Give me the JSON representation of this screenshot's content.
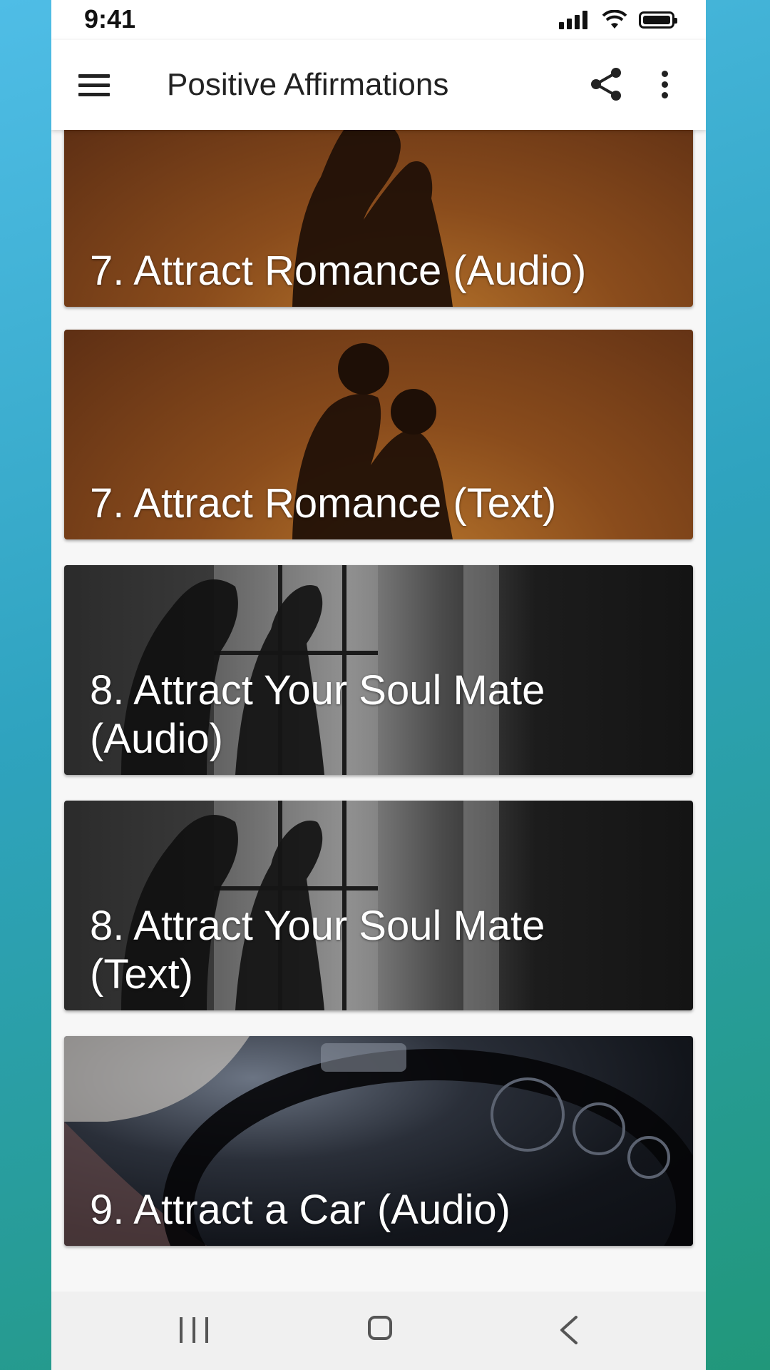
{
  "status_bar": {
    "time": "9:41",
    "icons": [
      "signal-icon",
      "wifi-icon",
      "battery-icon"
    ]
  },
  "app_bar": {
    "title": "Positive Affirmations",
    "icons": [
      "menu-icon",
      "share-icon",
      "more-vert-icon"
    ]
  },
  "list": {
    "items": [
      {
        "title": "7. Attract Romance (Audio)",
        "image": "couple-kissing-sunset"
      },
      {
        "title": "7. Attract Romance (Text)",
        "image": "couple-kissing-sunset"
      },
      {
        "title": "8. Attract Your Soul Mate (Audio)",
        "image": "couple-window-silhouette"
      },
      {
        "title": "8. Attract Your Soul Mate (Text)",
        "image": "couple-window-silhouette"
      },
      {
        "title": "9. Attract a Car (Audio)",
        "image": "car-steering-wheel"
      }
    ]
  },
  "nav_bar": {
    "icons": [
      "recents-icon",
      "home-icon",
      "back-icon"
    ]
  },
  "colors": {
    "page_background_start": "#4fbde6",
    "page_background_end": "#21977a",
    "app_bar": "#ffffff",
    "card_text": "#ffffff"
  }
}
